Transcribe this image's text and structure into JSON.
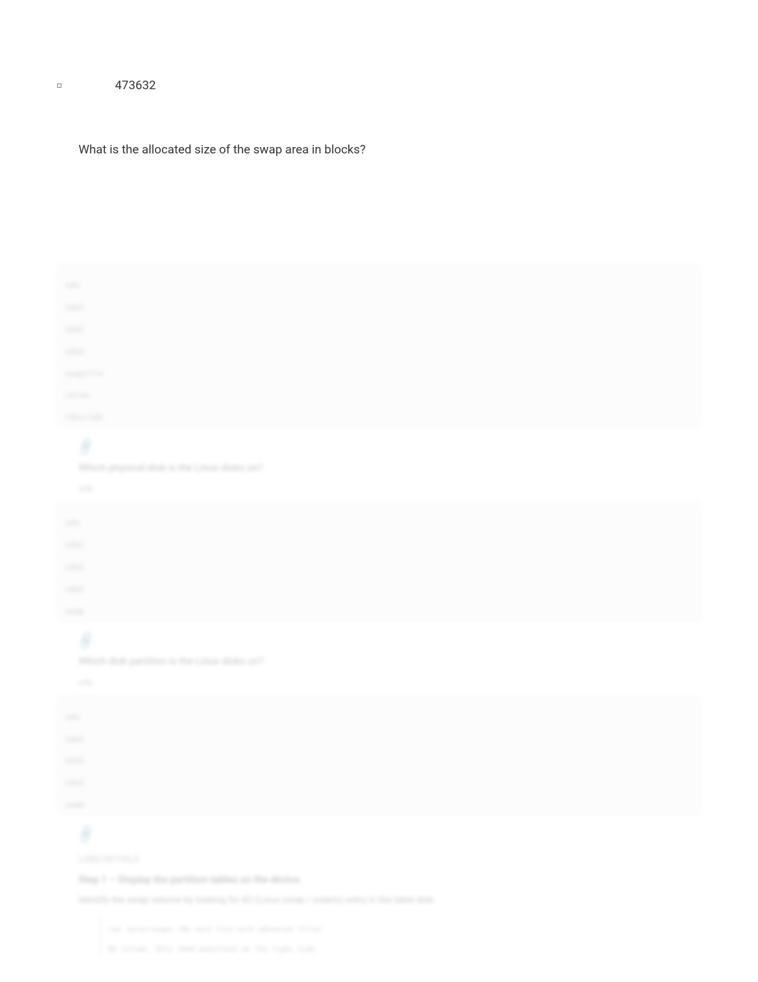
{
  "clear": {
    "answer_value": "473632",
    "question": "What is the allocated size of the swap area in blocks?"
  },
  "faded": {
    "code1_lines": [
      "sda",
      "sda1",
      "sda2",
      "sda3",
      "swapfile",
      "cdrom",
      "/dev/sda"
    ],
    "q2": "Which physical disk is the Linux disks on?",
    "a2": "sda",
    "code2_lines": [
      "sda",
      "sda1",
      "sda2",
      "sda3",
      "swap"
    ],
    "q3": "Which disk partition is the Linux disks on?",
    "a3": "sda",
    "code3_lines": [
      "sda",
      "sda1",
      "sda2",
      "sda3",
      "swap"
    ],
    "lab_heading": "LABS DETAILS",
    "step_heading": "Step 1 – Display the partition tables on the device",
    "step_text": "Identify the swap volume by looking for 82 (Linux swap / solaris) entry in the table disk.",
    "cmd1": "cat /proc/swaps (No such file with advanced filter",
    "cmd2": "No column. Only 1960 questions on the right side."
  }
}
